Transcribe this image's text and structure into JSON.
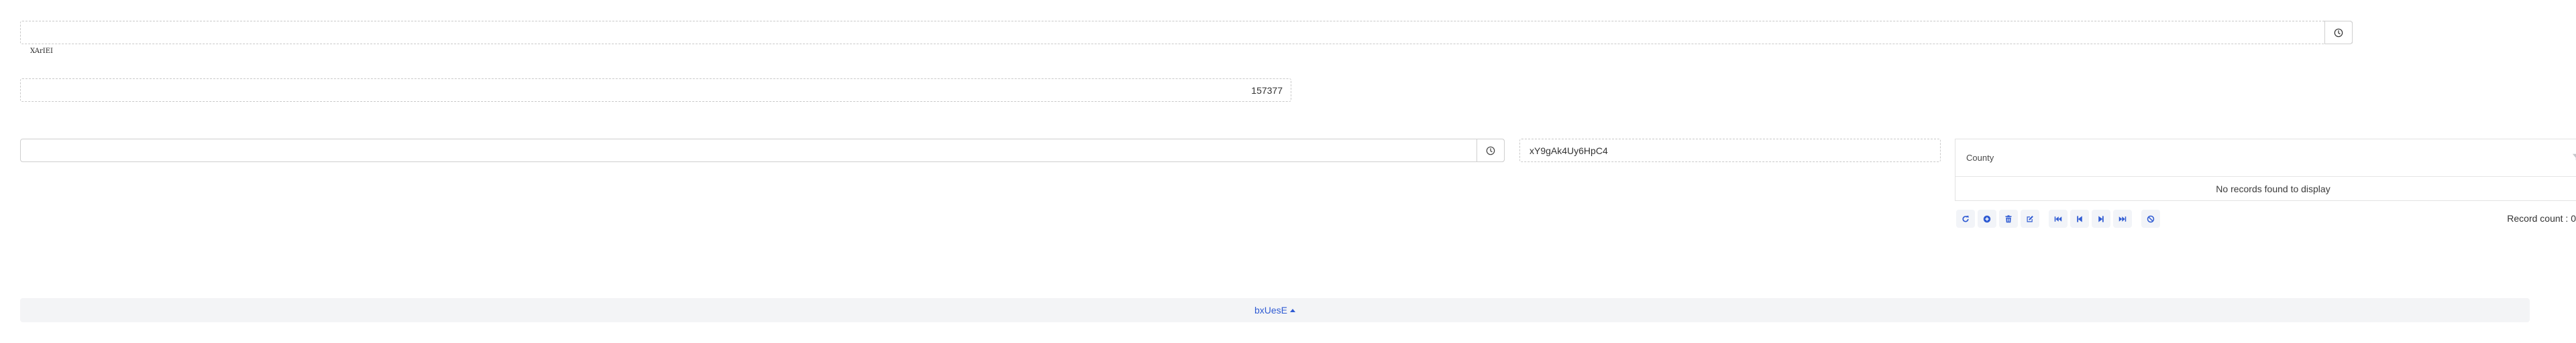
{
  "form": {
    "field1": {
      "value": "",
      "label": "XArIEI",
      "button_icon": "clock-icon"
    },
    "field2": {
      "value": "157377"
    },
    "field3": {
      "value": "",
      "button_icon": "clock-icon"
    },
    "field4": {
      "value": "xY9gAk4Uy6HpC4"
    }
  },
  "grid": {
    "columns": [
      {
        "label": "County",
        "icon": "filter-icon"
      }
    ],
    "empty_message": "No records found to display",
    "toolbar": [
      {
        "name": "refresh",
        "icon": "refresh-icon"
      },
      {
        "name": "add",
        "icon": "plus-circle-icon"
      },
      {
        "name": "delete",
        "icon": "trash-icon"
      },
      {
        "name": "edit",
        "icon": "edit-icon"
      },
      {
        "name": "first-page",
        "icon": "fast-backward-icon"
      },
      {
        "name": "previous-page",
        "icon": "step-backward-icon"
      },
      {
        "name": "next-page",
        "icon": "step-forward-icon"
      },
      {
        "name": "last-page",
        "icon": "fast-forward-icon"
      },
      {
        "name": "cancel",
        "icon": "ban-icon"
      }
    ],
    "record_count_label": "Record count : 0"
  },
  "footer": {
    "link_label": "bxUesE",
    "link_icon": "caret-up-icon"
  },
  "colors": {
    "accent": "#2f5bd3",
    "toolbar_bg": "#f2f4f8",
    "footer_bg": "#f3f4f6"
  }
}
